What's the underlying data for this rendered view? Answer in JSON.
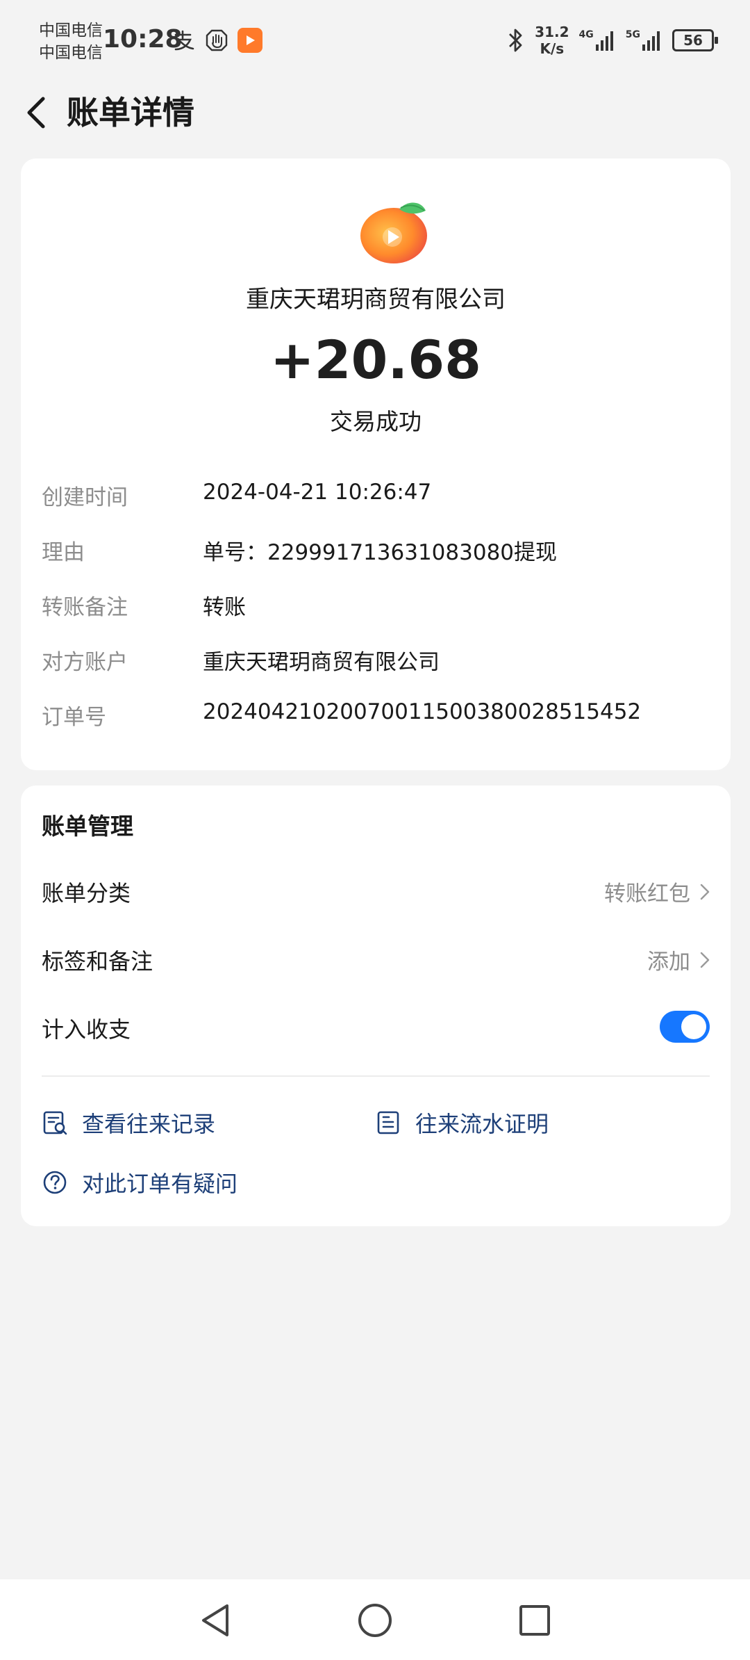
{
  "status_bar": {
    "carrier_1": "中国电信",
    "carrier_2": "中国电信",
    "time": "10:28",
    "speed_value": "31.2",
    "speed_unit": "K/s",
    "net_1": "4G",
    "net_2": "5G",
    "battery": "56",
    "icons": [
      "alipay-icon",
      "hand-icon",
      "video-app-icon",
      "bluetooth-icon",
      "signal-icon"
    ]
  },
  "header": {
    "title": "账单详情"
  },
  "transaction": {
    "merchant": "重庆天珺玥商贸有限公司",
    "amount": "+20.68",
    "status": "交易成功",
    "details": [
      {
        "label": "创建时间",
        "value": "2024-04-21 10:26:47"
      },
      {
        "label": "理由",
        "value": "单号：229991713631083080提现"
      },
      {
        "label": "转账备注",
        "value": "转账"
      },
      {
        "label": "对方账户",
        "value": "重庆天珺玥商贸有限公司"
      },
      {
        "label": "订单号",
        "value": "20240421020070011500380028515452"
      }
    ]
  },
  "management": {
    "title": "账单管理",
    "category_label": "账单分类",
    "category_value": "转账红包",
    "tags_label": "标签和备注",
    "tags_value": "添加",
    "count_label": "计入收支",
    "count_enabled": true,
    "links": {
      "history": "查看往来记录",
      "proof": "往来流水证明",
      "question": "对此订单有疑问"
    }
  },
  "colors": {
    "accent": "#1677ff",
    "link": "#1d3f78",
    "label_gray": "#8d8d8d",
    "background": "#f3f3f3"
  }
}
